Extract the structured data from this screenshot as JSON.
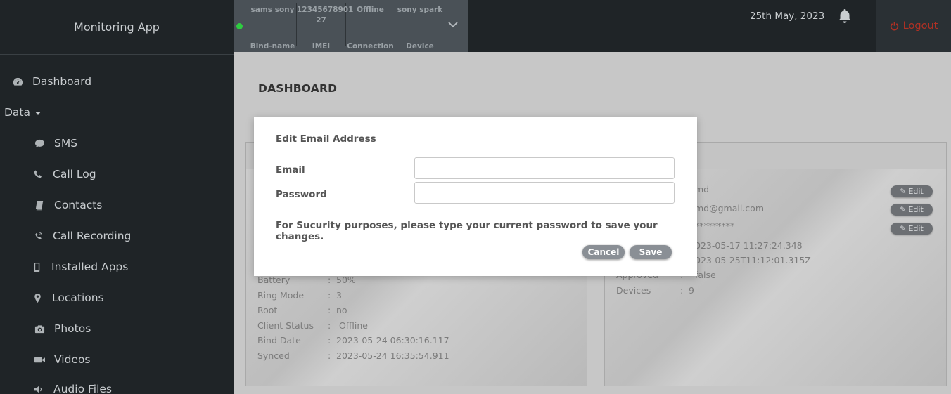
{
  "app": {
    "title": "Monitoring App"
  },
  "sidebar": {
    "items": [
      {
        "label": "Dashboard",
        "icon": "dashboard-icon"
      },
      {
        "label": "Data",
        "icon": "caret-down-icon"
      },
      {
        "label": "SMS",
        "icon": "comment-icon"
      },
      {
        "label": "Call Log",
        "icon": "phone-icon"
      },
      {
        "label": "Contacts",
        "icon": "book-icon"
      },
      {
        "label": "Call Recording",
        "icon": "volume-control-phone-icon"
      },
      {
        "label": "Installed Apps",
        "icon": "mobile-icon"
      },
      {
        "label": "Locations",
        "icon": "map-marker-icon"
      },
      {
        "label": "Photos",
        "icon": "camera-icon"
      },
      {
        "label": "Videos",
        "icon": "video-camera-icon"
      },
      {
        "label": "Audio Files",
        "icon": "volume-icon"
      }
    ]
  },
  "device_bar": {
    "columns": [
      {
        "value": "sams sony",
        "label": "Bind-name"
      },
      {
        "value": "12345678901 27",
        "label": "IMEI"
      },
      {
        "value": "Offline",
        "label": "Connection"
      },
      {
        "value": "sony spark",
        "label": "Device"
      }
    ],
    "status_color": "#2ecc40"
  },
  "header": {
    "date": "25th May, 2023",
    "logout_label": "Logout"
  },
  "main": {
    "page_title": "DASHBOARD",
    "device_card": {
      "rows": [
        {
          "key": "Battery",
          "value": "50%"
        },
        {
          "key": "Ring Mode",
          "value": "3"
        },
        {
          "key": "Root",
          "value": "no"
        },
        {
          "key": "Client Status",
          "value": " Offline"
        },
        {
          "key": "Bind Date",
          "value": "2023-05-24 06:30:16.117"
        },
        {
          "key": "Synced",
          "value": "2023-05-24 16:35:54.911"
        }
      ]
    },
    "account_card": {
      "rows": [
        {
          "key": "",
          "value": "md"
        },
        {
          "key": "",
          "value": "md@gmail.com"
        },
        {
          "key": "",
          "value": "*********"
        },
        {
          "key": "",
          "value": "023-05-17 11:27:24.348"
        },
        {
          "key": "",
          "value": "023-05-25T11:12:01.315Z"
        },
        {
          "key": "Approved",
          "value": "false"
        },
        {
          "key": "Devices",
          "value": "9"
        }
      ],
      "edit_label": "Edit"
    }
  },
  "modal": {
    "title": "Edit Email Address",
    "email_label": "Email",
    "email_value": "",
    "password_label": "Password",
    "password_value": "",
    "note": "For Sucurity purposes, please type your current password to save your changes.",
    "cancel_label": "Cancel",
    "save_label": "Save"
  },
  "colors": {
    "sidebar_bg": "#1f2427",
    "logout": "#b03024",
    "button": "#8a8f95"
  }
}
